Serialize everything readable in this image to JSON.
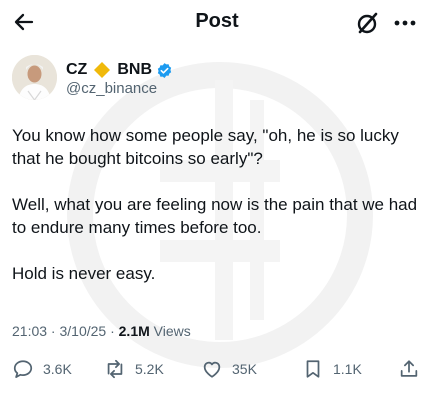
{
  "header": {
    "title": "Post"
  },
  "author": {
    "name": "CZ",
    "name_suffix": "BNB",
    "handle": "@cz_binance",
    "verified": true,
    "badge_color": "#f0b90b",
    "verified_color": "#1d9bf0"
  },
  "tweet": {
    "paragraphs": [
      "You know how some people say, \"oh, he is so lucky that he bought bitcoins so early\"?",
      "Well, what you are feeling now is the pain that we had to endure many times before too.",
      "Hold is never easy."
    ],
    "time": "21:03 · 3/10/25 · ",
    "views_count": "2.1M",
    "views_label": " Views"
  },
  "actions": {
    "replies": "3.6K",
    "reposts": "5.2K",
    "likes": "35K",
    "bookmarks": "1.1K"
  },
  "icons": {
    "back": "arrow-left-icon",
    "grok": "grok-icon",
    "more": "more-dots-icon",
    "reply": "reply-icon",
    "repost": "repost-icon",
    "like": "heart-icon",
    "bookmark": "bookmark-icon",
    "share": "share-icon"
  },
  "colors": {
    "text": "#0f1419",
    "secondary": "#536471"
  }
}
